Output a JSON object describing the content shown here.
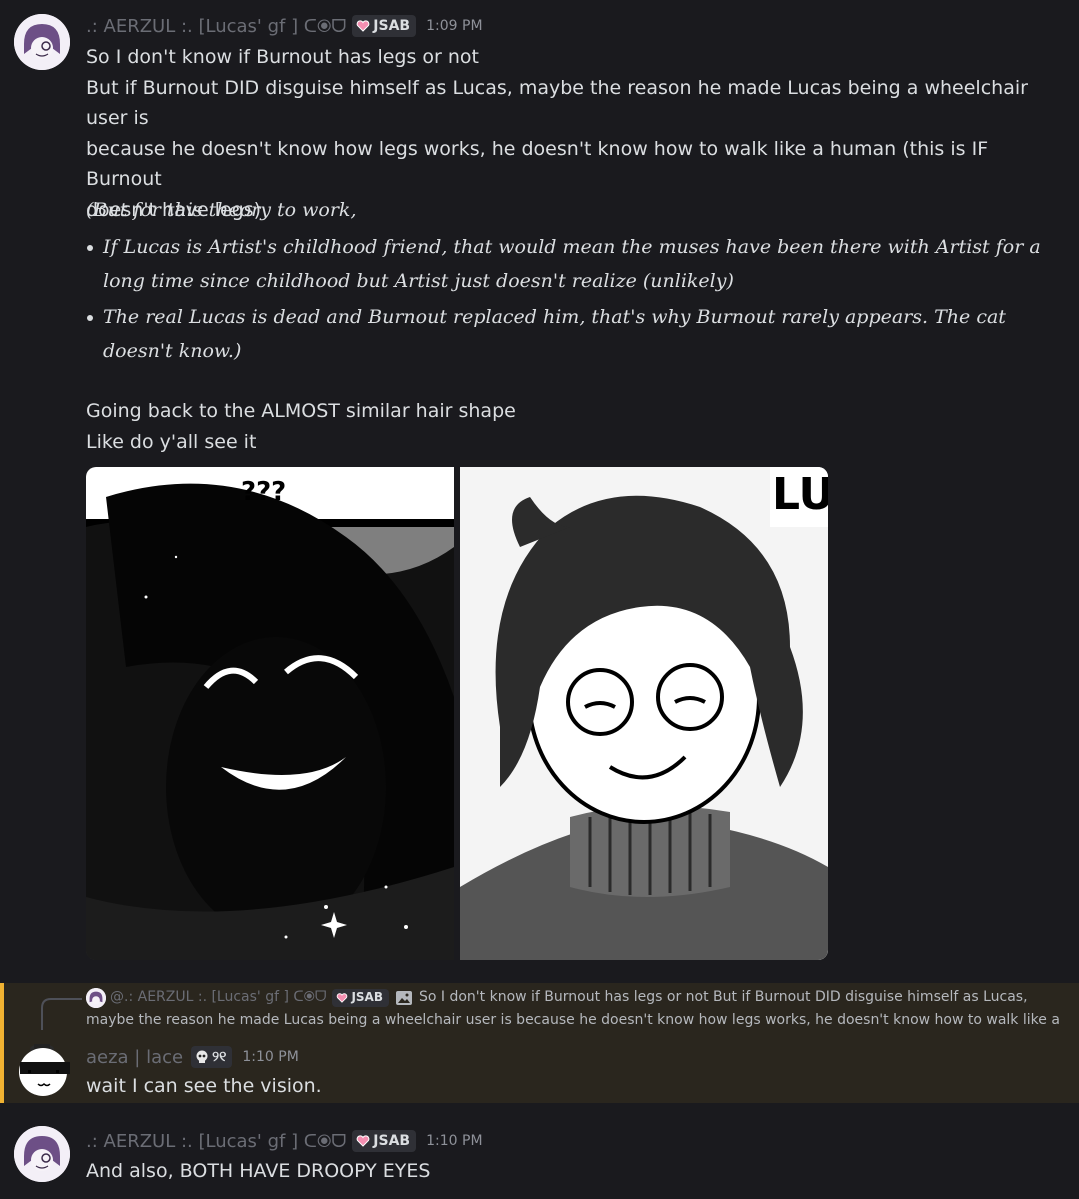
{
  "msg1": {
    "author": ".: AERZUL :. [Lucas' gf ] ᑕ⦿ᗜ",
    "tag": "JSAB",
    "time": "1:09 PM",
    "lines": [
      "So I don't know if Burnout has legs or not",
      "But if Burnout DID disguise himself as Lucas, maybe the reason he made Lucas being a wheelchair user is",
      "because he doesn't know how legs works, he doesn't know how to walk like a human (this is IF Burnout",
      "doesn't have legs)"
    ],
    "italic_intro": "(But for this theory to work,",
    "bullets": [
      "If Lucas is Artist's childhood friend, that would mean the muses have been there with Artist for a long time since childhood but Artist just doesn't realize (unlikely)",
      "The real Lucas is dead and Burnout replaced him, that's why Burnout rarely appears. The cat doesn't know.)"
    ],
    "after": [
      "Going back to the ALMOST similar hair shape",
      "Like do y'all see it"
    ],
    "image_left_caption": "???",
    "image_right_caption": "LU"
  },
  "reply": {
    "author": "@.: AERZUL :. [Lucas' gf ] ᑕ⦿ᗜ",
    "tag": "JSAB",
    "preview": "So I don't know if Burnout has legs or not But if Burnout DID disguise himself as Lucas,",
    "preview2": "maybe the reason he made Lucas being a wheelchair user is because he doesn't know how legs works, he doesn't know how to walk like a"
  },
  "msg2": {
    "author": "aeza | lace",
    "tag": "୨୧",
    "time": "1:10 PM",
    "text": "wait I can see the vision."
  },
  "msg3": {
    "author": ".: AERZUL :. [Lucas' gf ] ᑕ⦿ᗜ",
    "tag": "JSAB",
    "time": "1:10 PM",
    "text": "And also, BOTH HAVE DROOPY EYES"
  },
  "colors": {
    "background": "#1a1a1e",
    "mention_highlight": "#2a261e",
    "mention_bar": "#f0b232",
    "text": "#dbdee1",
    "muted_name": "#6b6d75"
  }
}
